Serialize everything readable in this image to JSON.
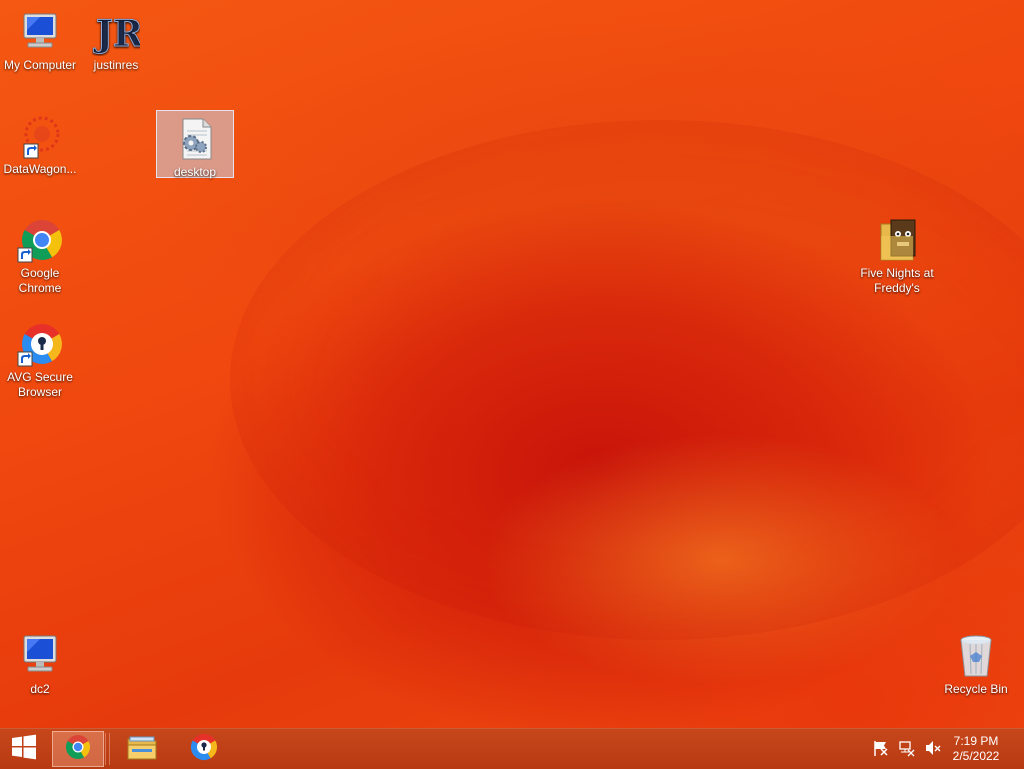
{
  "desktop": {
    "icons": {
      "my_computer": "My Computer",
      "justinres": "justinres",
      "datawagon": "DataWagon...",
      "desktop_file": "desktop",
      "google_chrome": "Google Chrome",
      "avg_secure_browser": "AVG Secure Browser",
      "five_nights": "Five Nights at Freddy's",
      "dc2": "dc2",
      "recycle_bin": "Recycle Bin"
    }
  },
  "taskbar": {
    "start_icon": "windows-logo-icon",
    "pinned": [
      "chrome-icon",
      "file-explorer-icon",
      "avg-browser-icon"
    ],
    "tray_icons": [
      "action-center-flag-icon",
      "network-icon",
      "volume-muted-icon"
    ],
    "clock": {
      "time": "7:19 PM",
      "date": "2/5/2022"
    }
  },
  "colors": {
    "wallpaper_primary": "#f24a10",
    "wallpaper_dark": "#c8140a",
    "taskbar": "#c0401a"
  }
}
